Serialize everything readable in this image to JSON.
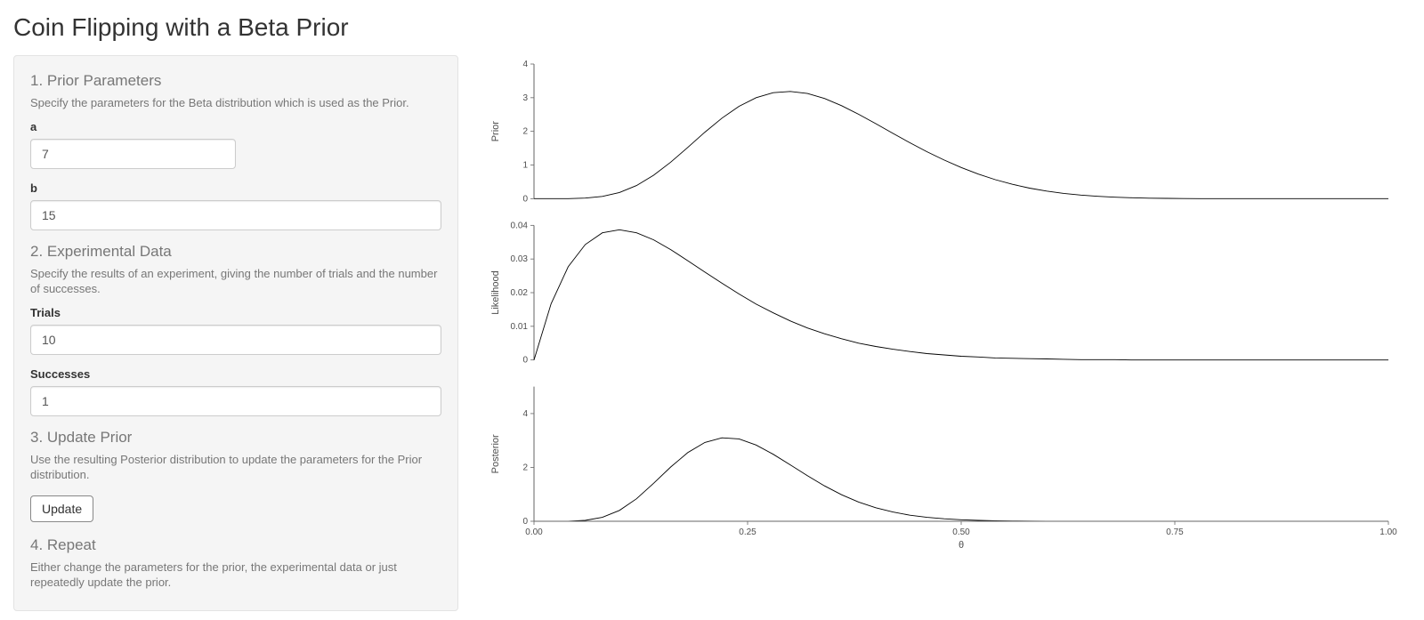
{
  "title": "Coin Flipping with a Beta Prior",
  "sidebar": {
    "sec1": {
      "title": "1. Prior Parameters",
      "help": "Specify the parameters for the Beta distribution which is used as the Prior."
    },
    "a": {
      "label": "a",
      "value": "7"
    },
    "b": {
      "label": "b",
      "value": "15"
    },
    "sec2": {
      "title": "2. Experimental Data",
      "help": "Specify the results of an experiment, giving the number of trials and the number of successes."
    },
    "trials": {
      "label": "Trials",
      "value": "10"
    },
    "successes": {
      "label": "Successes",
      "value": "1"
    },
    "sec3": {
      "title": "3. Update Prior",
      "help": "Use the resulting Posterior distribution to update the parameters for the Prior distribution."
    },
    "update_label": "Update",
    "sec4": {
      "title": "4. Repeat",
      "help": "Either change the parameters for the prior, the experimental data or just repeatedly update the prior."
    }
  },
  "chart_data": [
    {
      "type": "line",
      "name": "prior",
      "ylabel": "Prior",
      "ylim": [
        0,
        4
      ],
      "yticks": [
        0,
        1,
        2,
        3,
        4
      ],
      "x": [
        0.0,
        0.02,
        0.04,
        0.06,
        0.08,
        0.1,
        0.12,
        0.14,
        0.16,
        0.18,
        0.2,
        0.22,
        0.24,
        0.26,
        0.28,
        0.3,
        0.32,
        0.34,
        0.36,
        0.38,
        0.4,
        0.42,
        0.44,
        0.46,
        0.48,
        0.5,
        0.52,
        0.54,
        0.56,
        0.58,
        0.6,
        0.62,
        0.64,
        0.66,
        0.68,
        0.7,
        0.72,
        0.74,
        0.76,
        0.78,
        0.8,
        0.82,
        0.84,
        0.86,
        0.88,
        0.9,
        0.92,
        0.94,
        0.96,
        0.98,
        1.0
      ],
      "values": [
        0.0,
        0.0,
        0.002,
        0.017,
        0.068,
        0.184,
        0.39,
        0.696,
        1.084,
        1.524,
        1.975,
        2.394,
        2.744,
        3.0,
        3.149,
        3.187,
        3.124,
        2.976,
        2.763,
        2.507,
        2.228,
        1.942,
        1.661,
        1.394,
        1.148,
        0.926,
        0.731,
        0.565,
        0.426,
        0.314,
        0.225,
        0.157,
        0.106,
        0.069,
        0.043,
        0.026,
        0.015,
        0.008,
        0.004,
        0.002,
        0.001,
        0.0,
        0.0,
        0.0,
        0.0,
        0.0,
        0.0,
        0.0,
        0.0,
        0.0,
        0.0
      ]
    },
    {
      "type": "line",
      "name": "likelihood",
      "ylabel": "Likelihood",
      "ylim": [
        0,
        0.04
      ],
      "yticks": [
        0.0,
        0.01,
        0.02,
        0.03,
        0.04
      ],
      "x": [
        0.0,
        0.02,
        0.04,
        0.06,
        0.08,
        0.1,
        0.12,
        0.14,
        0.16,
        0.18,
        0.2,
        0.22,
        0.24,
        0.26,
        0.28,
        0.3,
        0.32,
        0.34,
        0.36,
        0.38,
        0.4,
        0.42,
        0.44,
        0.46,
        0.48,
        0.5,
        0.52,
        0.54,
        0.56,
        0.58,
        0.6,
        0.62,
        0.64,
        0.66,
        0.68,
        0.7,
        0.72,
        0.74,
        0.76,
        0.78,
        0.8,
        0.82,
        0.84,
        0.86,
        0.88,
        0.9,
        0.92,
        0.94,
        0.96,
        0.98,
        1.0
      ],
      "values": [
        0.0,
        0.0167,
        0.0277,
        0.0343,
        0.0378,
        0.0387,
        0.0378,
        0.0357,
        0.0328,
        0.0295,
        0.0261,
        0.0228,
        0.0196,
        0.0166,
        0.014,
        0.0116,
        0.0095,
        0.0078,
        0.0063,
        0.005,
        0.004,
        0.0032,
        0.0025,
        0.0019,
        0.0015,
        0.0011,
        0.0009,
        0.0006,
        0.0005,
        0.0004,
        0.0003,
        0.0002,
        0.0001,
        0.0001,
        0.0001,
        0.0,
        0.0,
        0.0,
        0.0,
        0.0,
        0.0,
        0.0,
        0.0,
        0.0,
        0.0,
        0.0,
        0.0,
        0.0,
        0.0,
        0.0,
        0.0
      ]
    },
    {
      "type": "line",
      "name": "posterior",
      "ylabel": "Posterior",
      "ylim": [
        0,
        5
      ],
      "yticks": [
        0,
        2,
        4
      ],
      "x": [
        0.0,
        0.02,
        0.04,
        0.06,
        0.08,
        0.1,
        0.12,
        0.14,
        0.16,
        0.18,
        0.2,
        0.22,
        0.24,
        0.26,
        0.28,
        0.3,
        0.32,
        0.34,
        0.36,
        0.38,
        0.4,
        0.42,
        0.44,
        0.46,
        0.48,
        0.5,
        0.52,
        0.54,
        0.56,
        0.58,
        0.6,
        0.62,
        0.64,
        0.66,
        0.68,
        0.7,
        0.72,
        0.74,
        0.76,
        0.78,
        0.8,
        0.82,
        0.84,
        0.86,
        0.88,
        0.9,
        0.92,
        0.94,
        0.96,
        0.98,
        1.0
      ],
      "values": [
        0.0,
        0.0,
        0.003,
        0.033,
        0.146,
        0.403,
        0.836,
        1.41,
        2.016,
        2.55,
        2.926,
        3.098,
        3.058,
        2.832,
        2.488,
        2.095,
        1.69,
        1.314,
        0.986,
        0.714,
        0.502,
        0.342,
        0.226,
        0.146,
        0.091,
        0.056,
        0.033,
        0.019,
        0.011,
        0.006,
        0.003,
        0.002,
        0.001,
        0.0,
        0.0,
        0.0,
        0.0,
        0.0,
        0.0,
        0.0,
        0.0,
        0.0,
        0.0,
        0.0,
        0.0,
        0.0,
        0.0,
        0.0,
        0.0,
        0.0,
        0.0
      ]
    }
  ],
  "xaxis": {
    "ticks": [
      0.0,
      0.25,
      0.5,
      0.75,
      1.0
    ],
    "tick_labels": [
      "0.00",
      "0.25",
      "0.50",
      "0.75",
      "1.00"
    ],
    "label": "θ"
  }
}
